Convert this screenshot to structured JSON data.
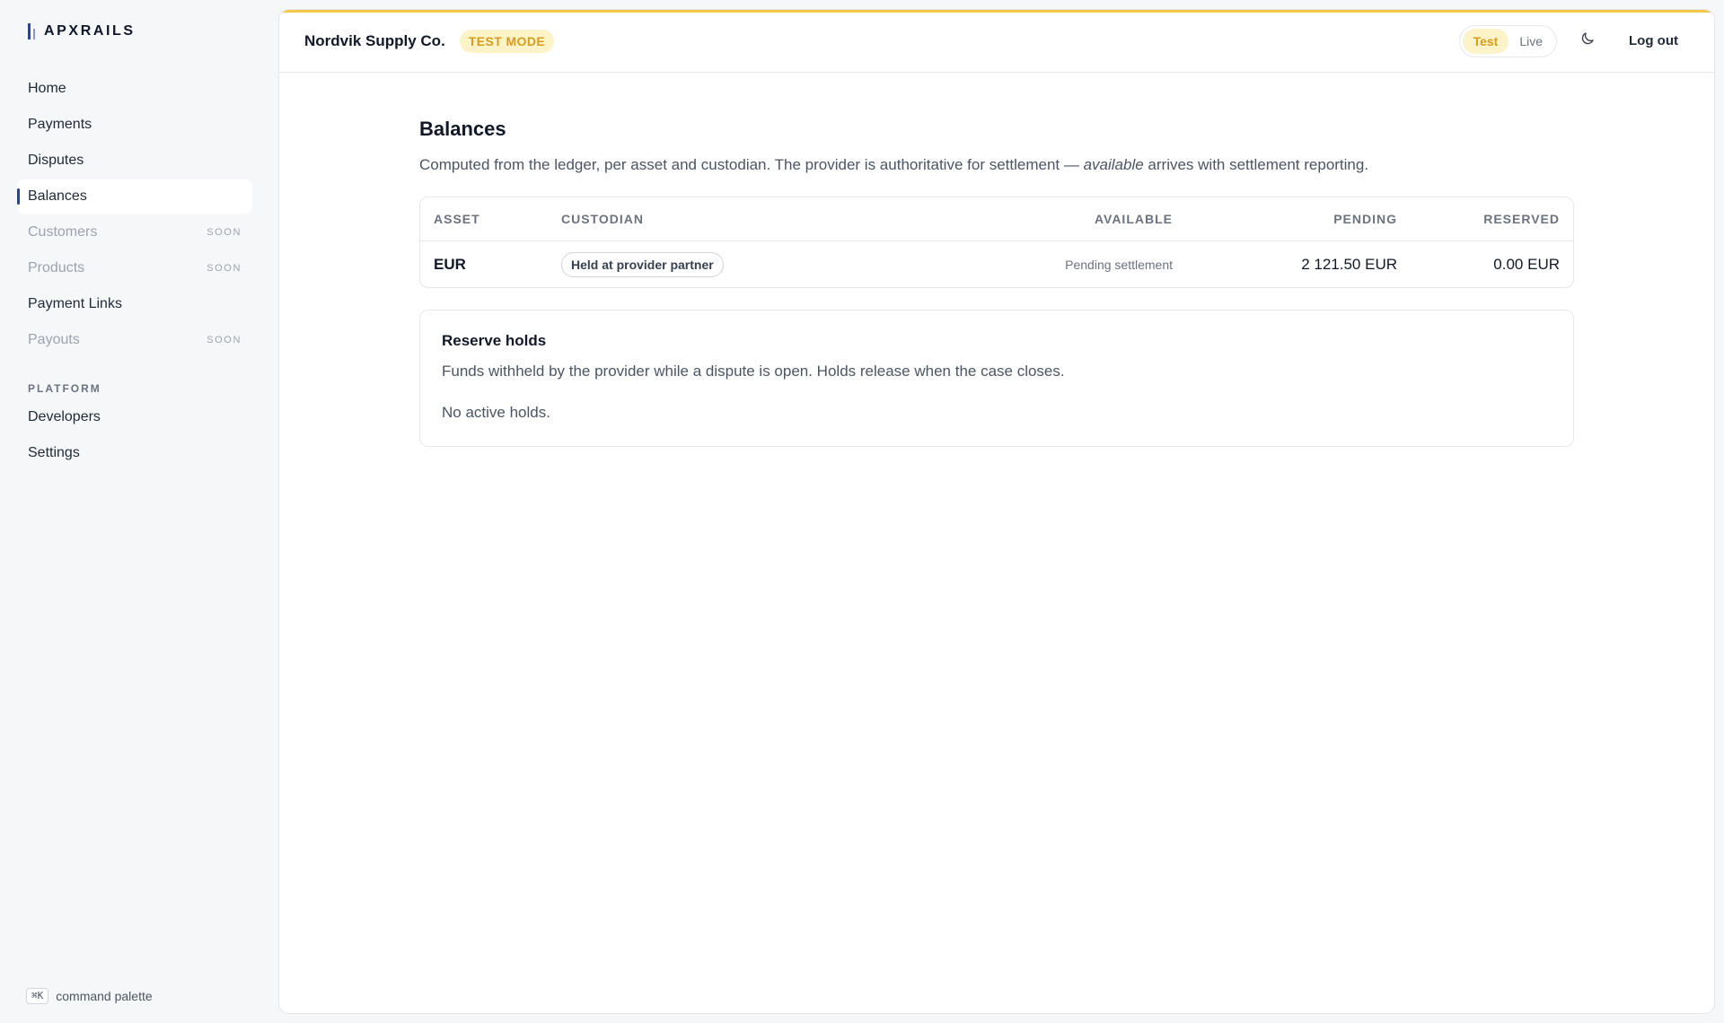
{
  "brand": {
    "name": "APXRAILS"
  },
  "sidebar": {
    "items": [
      {
        "label": "Home",
        "soon": ""
      },
      {
        "label": "Payments",
        "soon": ""
      },
      {
        "label": "Disputes",
        "soon": ""
      },
      {
        "label": "Balances",
        "soon": ""
      },
      {
        "label": "Customers",
        "soon": "SOON"
      },
      {
        "label": "Products",
        "soon": "SOON"
      },
      {
        "label": "Payment Links",
        "soon": ""
      },
      {
        "label": "Payouts",
        "soon": "SOON"
      }
    ],
    "section_label": "PLATFORM",
    "platform_items": [
      {
        "label": "Developers"
      },
      {
        "label": "Settings"
      }
    ],
    "command_hint": {
      "key": "⌘K",
      "label": "command palette"
    }
  },
  "topbar": {
    "org_name": "Nordvik Supply Co.",
    "mode_badge": "TEST MODE",
    "mode_options": [
      "Test",
      "Live"
    ],
    "logout_label": "Log out"
  },
  "page": {
    "title": "Balances",
    "subtitle_before": "Computed from the ledger, per asset and custodian. The provider is authoritative for settlement — ",
    "subtitle_emphasis": "available",
    "subtitle_after": " arrives with settlement reporting."
  },
  "balances_table": {
    "columns": [
      "ASSET",
      "CUSTODIAN",
      "AVAILABLE",
      "PENDING",
      "RESERVED"
    ],
    "rows": [
      {
        "asset": "EUR",
        "custodian": "Held at provider partner",
        "available": "Pending settlement",
        "pending": "2 121.50 EUR",
        "reserved": "0.00 EUR"
      }
    ]
  },
  "reserve_holds": {
    "title": "Reserve holds",
    "description": "Funds withheld by the provider while a dispute is open. Holds release when the case closes.",
    "empty": "No active holds."
  },
  "colors": {
    "accent": "#2b3fa8",
    "test_mode_bg": "#fdf3c9",
    "test_mode_text": "#d69e1a",
    "top_stripe": "#f3c74a"
  },
  "icons": {
    "theme_toggle": "moon-icon"
  }
}
